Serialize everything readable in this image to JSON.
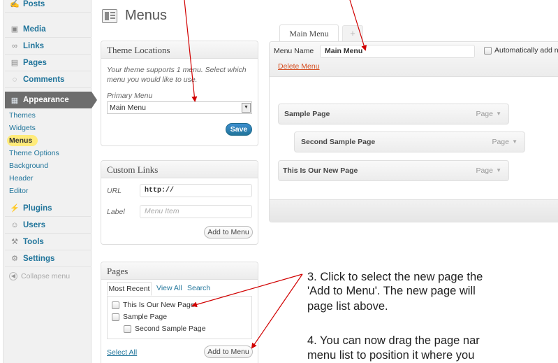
{
  "sidebar": {
    "items_top": [
      {
        "label": "Posts",
        "icon": "pin-icon"
      },
      {
        "label": "Media",
        "icon": "media-icon"
      },
      {
        "label": "Links",
        "icon": "links-icon"
      },
      {
        "label": "Pages",
        "icon": "pages-icon"
      },
      {
        "label": "Comments",
        "icon": "comments-icon"
      }
    ],
    "appearance": {
      "label": "Appearance",
      "icon": "appearance-icon"
    },
    "submenu": [
      "Themes",
      "Widgets",
      "Menus",
      "Theme Options",
      "Background",
      "Header",
      "Editor"
    ],
    "items_bottom": [
      {
        "label": "Plugins",
        "icon": "plugins-icon"
      },
      {
        "label": "Users",
        "icon": "users-icon"
      },
      {
        "label": "Tools",
        "icon": "tools-icon"
      },
      {
        "label": "Settings",
        "icon": "settings-icon"
      }
    ],
    "collapse_label": "Collapse menu"
  },
  "page_title": "Menus",
  "theme_locations": {
    "title": "Theme Locations",
    "description_line1": "Your theme supports 1 menu. Select which",
    "description_line2": "menu you would like to use.",
    "primary_label": "Primary Menu",
    "primary_value": "Main Menu",
    "save_label": "Save"
  },
  "custom_links": {
    "title": "Custom Links",
    "url_label": "URL",
    "url_value": "http://",
    "label_label": "Label",
    "label_placeholder": "Menu Item",
    "add_label": "Add to Menu"
  },
  "pages_box": {
    "title": "Pages",
    "tabs": [
      "Most Recent",
      "View All",
      "Search"
    ],
    "items": [
      "This Is Our New Page",
      "Sample Page",
      "Second Sample Page"
    ],
    "select_all": "Select All",
    "add_label": "Add to Menu"
  },
  "editor": {
    "tab_main": "Main Menu",
    "tab_add": "+",
    "menu_name_label": "Menu Name",
    "menu_name_value": "Main Menu",
    "auto_add_label": "Automatically add nev",
    "delete_label": "Delete Menu",
    "items": [
      {
        "title": "Sample Page",
        "type": "Page"
      },
      {
        "title": "Second Sample Page",
        "type": "Page"
      },
      {
        "title": "This Is Our New Page",
        "type": "Page"
      }
    ]
  },
  "instructions": {
    "step3_line1": "3. Click to select the new page the",
    "step3_line2": "'Add to Menu'. The new page will",
    "step3_line3": "page list above.",
    "step4_line1": "4. You can now drag the page nar",
    "step4_line2": "menu list to position it where you"
  },
  "colors": {
    "link": "#21759b",
    "active_menu_bg": "#6d6d6d",
    "highlight": "#ffeb7a",
    "delete": "#d54e21",
    "arrow": "#d10000"
  }
}
